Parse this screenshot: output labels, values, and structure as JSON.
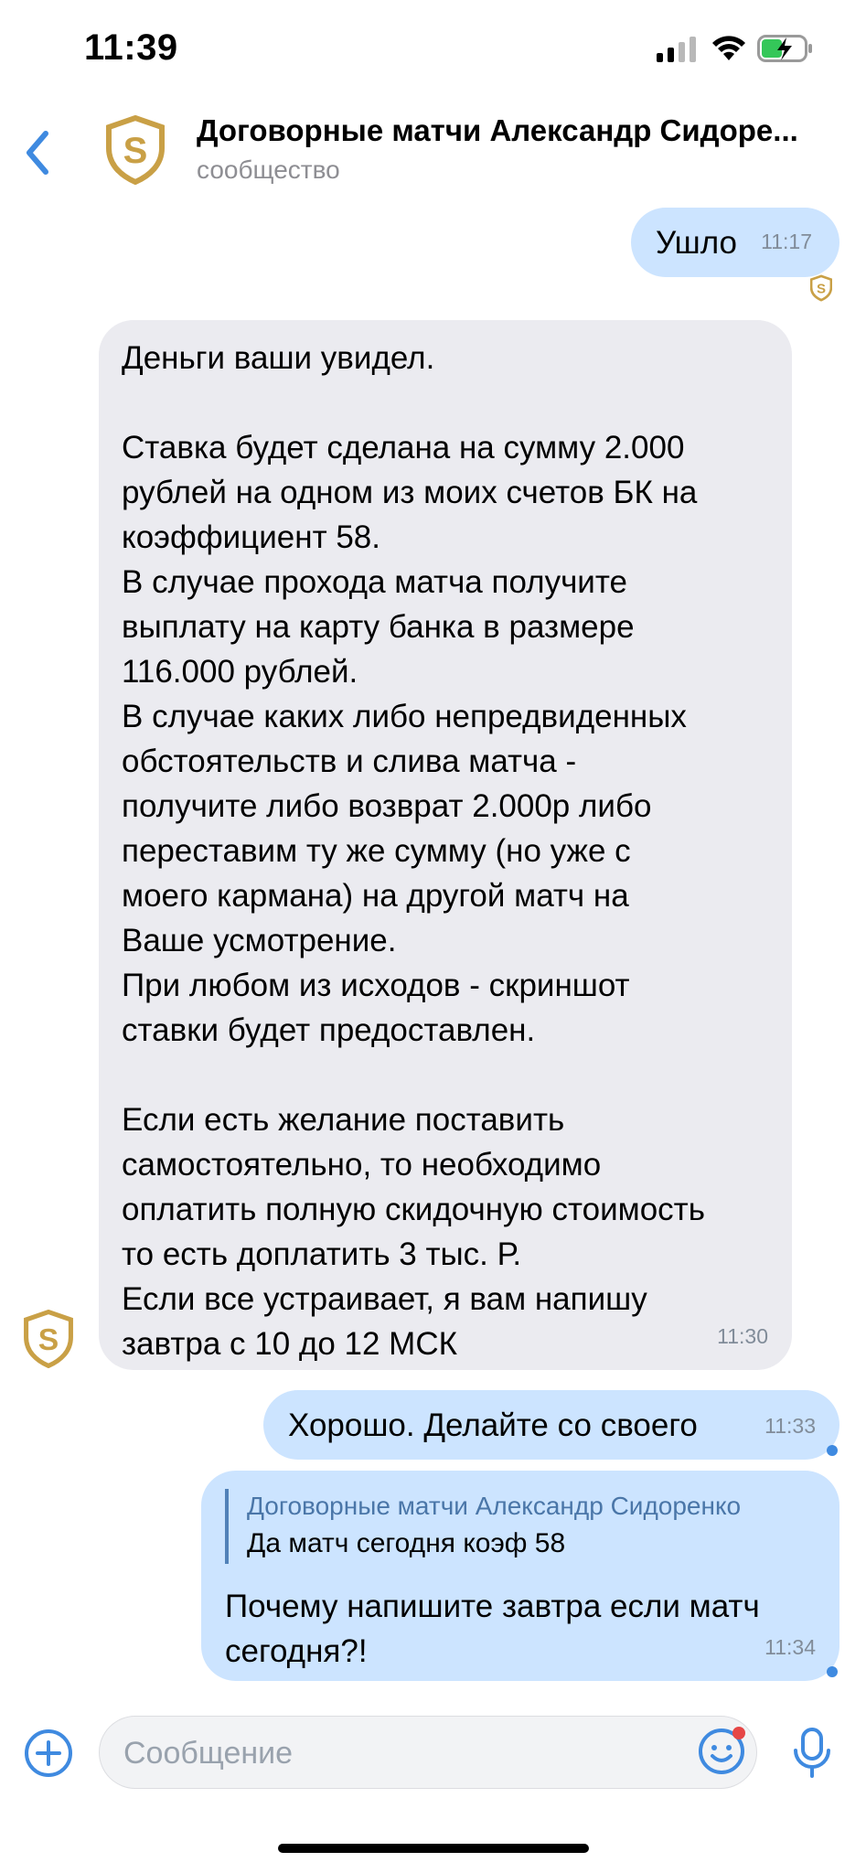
{
  "status_bar": {
    "time": "11:39"
  },
  "header": {
    "title": "Договорные матчи Александр Сидоре...",
    "subtitle": "сообщество"
  },
  "messages": [
    {
      "direction": "outgoing",
      "text": "Ушло",
      "time": "11:17"
    },
    {
      "direction": "incoming",
      "text": "Деньги ваши увидел.\n\nСтавка будет сделана на сумму 2.000\nрублей на одном из моих счетов БК на\nкоэффициент 58.\nВ случае прохода матча получите\nвыплату на карту банка в размере\n116.000 рублей.\nВ случае каких либо непредвиденных\nобстоятельств и слива матча -\nполучите либо возврат 2.000р либо\nпереставим ту же сумму (но уже с\nмоего кармана) на другой матч на\nВаше усмотрение.\nПри любом из исходов - скриншот\nставки будет предоставлен.\n\nЕсли есть желание поставить\nсамостоятельно, то необходимо\nоплатить полную скидочную стоимость\nто есть доплатить 3 тыс. Р.\nЕсли все устраивает, я вам напишу\nзавтра с 10 до 12 МСК",
      "time": "11:30"
    },
    {
      "direction": "outgoing",
      "text": "Хорошо. Делайте со своего",
      "time": "11:33"
    },
    {
      "direction": "outgoing",
      "reply": {
        "author": "Договорные матчи Александр Сидоренко",
        "text": "Да матч сегодня коэф 58"
      },
      "text": "Почему напишите завтра если матч\nсегодня?!",
      "time": "11:34"
    }
  ],
  "composer": {
    "placeholder": "Сообщение"
  },
  "colors": {
    "accent": "#3f8ae0",
    "outgoing_bubble": "#cce4ff",
    "incoming_bubble": "#ebebf0",
    "community_logo": "#c9a046"
  },
  "icons": {
    "back": "chevron-left-icon",
    "add": "plus-circle-icon",
    "sticker": "smile-icon",
    "mic": "microphone-icon"
  }
}
